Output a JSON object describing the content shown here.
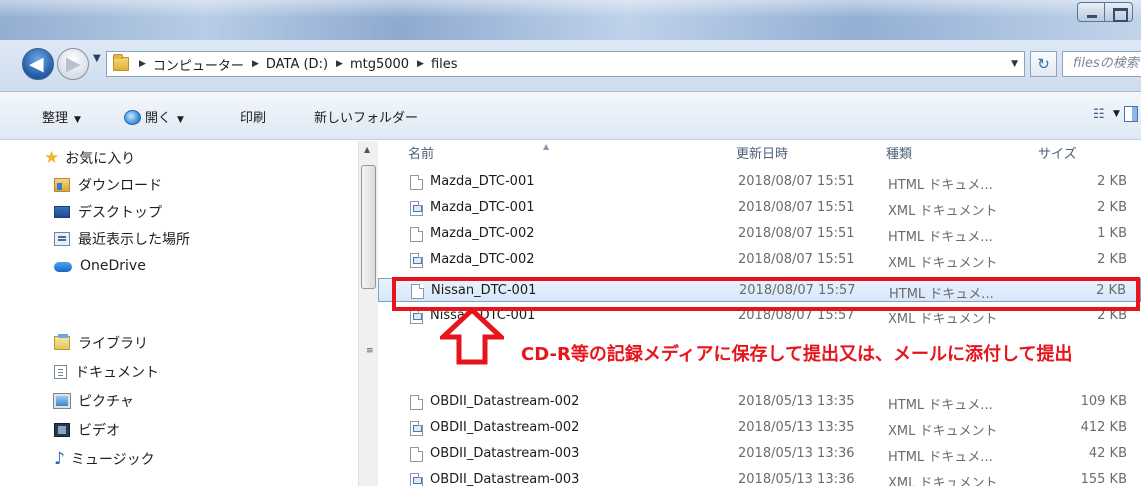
{
  "window": {
    "title": ""
  },
  "address": {
    "crumbs": [
      "コンピューター",
      "DATA (D:)",
      "mtg5000",
      "files"
    ],
    "search_placeholder": "filesの検索"
  },
  "toolbar": {
    "organize": "整理",
    "open": "開く",
    "print": "印刷",
    "new_folder": "新しいフォルダー"
  },
  "nav": {
    "favorites": "お気に入り",
    "downloads": "ダウンロード",
    "desktop": "デスクトップ",
    "recent": "最近表示した場所",
    "onedrive": "OneDrive",
    "libraries": "ライブラリ",
    "documents": "ドキュメント",
    "pictures": "ピクチャ",
    "videos": "ビデオ",
    "music": "ミュージック"
  },
  "columns": {
    "name": "名前",
    "date": "更新日時",
    "type": "種類",
    "size": "サイズ"
  },
  "files": [
    {
      "name": "Mazda_DTC-001",
      "date": "2018/08/07 15:51",
      "type": "HTML ドキュメ...",
      "size": "2 KB",
      "icon": "html-file-icon"
    },
    {
      "name": "Mazda_DTC-001",
      "date": "2018/08/07 15:51",
      "type": "XML ドキュメント",
      "size": "2 KB",
      "icon": "xml-file-icon"
    },
    {
      "name": "Mazda_DTC-002",
      "date": "2018/08/07 15:51",
      "type": "HTML ドキュメ...",
      "size": "1 KB",
      "icon": "html-file-icon"
    },
    {
      "name": "Mazda_DTC-002",
      "date": "2018/08/07 15:51",
      "type": "XML ドキュメント",
      "size": "2 KB",
      "icon": "xml-file-icon"
    },
    {
      "name": "Nissan_DTC-001",
      "date": "2018/08/07 15:57",
      "type": "HTML ドキュメ...",
      "size": "2 KB",
      "icon": "html-file-icon",
      "selected": true
    },
    {
      "name": "Nissan_DTC-001",
      "date": "2018/08/07 15:57",
      "type": "XML ドキュメント",
      "size": "2 KB",
      "icon": "xml-file-icon"
    },
    {
      "name": "OBDII_Datastream-002",
      "date": "2018/05/13 13:35",
      "type": "HTML ドキュメ...",
      "size": "109 KB",
      "icon": "html-file-icon"
    },
    {
      "name": "OBDII_Datastream-002",
      "date": "2018/05/13 13:35",
      "type": "XML ドキュメント",
      "size": "412 KB",
      "icon": "xml-file-icon"
    },
    {
      "name": "OBDII_Datastream-003",
      "date": "2018/05/13 13:36",
      "type": "HTML ドキュメ...",
      "size": "42 KB",
      "icon": "html-file-icon"
    },
    {
      "name": "OBDII_Datastream-003",
      "date": "2018/05/13 13:36",
      "type": "XML ドキュメント",
      "size": "155 KB",
      "icon": "xml-file-icon"
    }
  ],
  "annotation": {
    "text": "CD-R等の記録メディアに保存して提出又は、メールに添付して提出",
    "color": "#e8141c"
  }
}
